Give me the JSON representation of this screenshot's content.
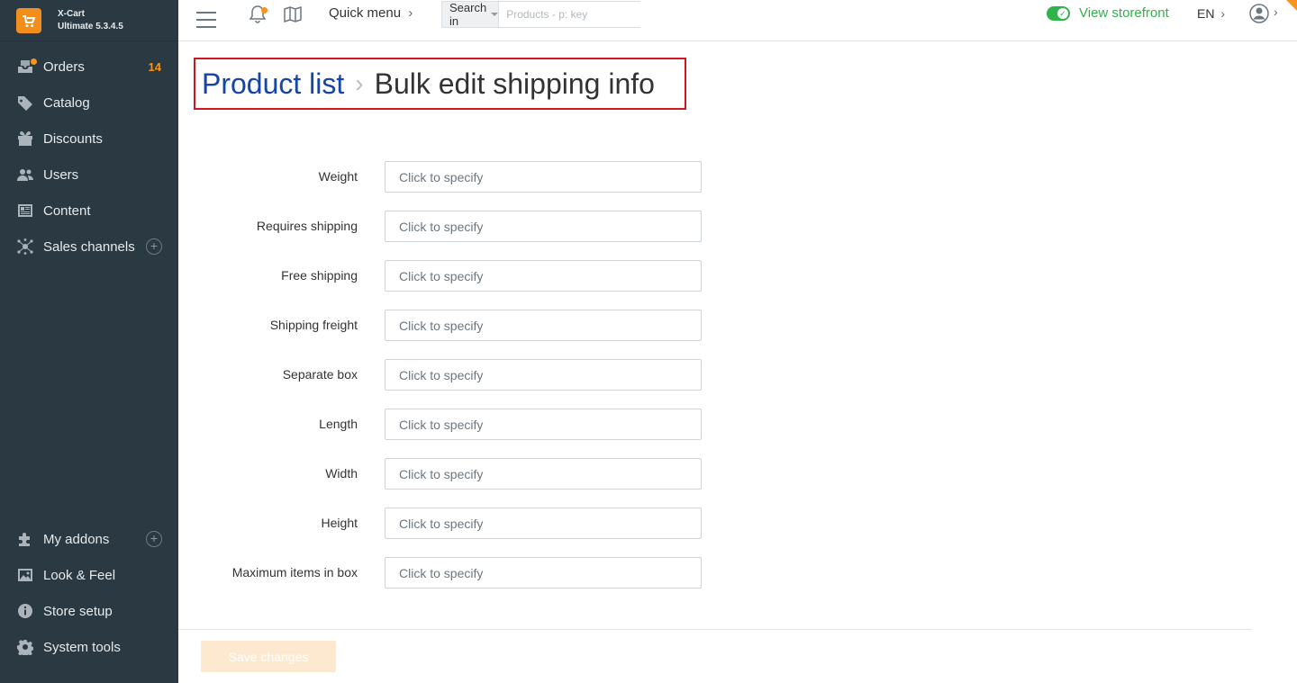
{
  "app": {
    "name": "X-Cart",
    "version": "Ultimate 5.3.4.5",
    "accent": "#f7941d",
    "link_color": "#1645a8",
    "success_color": "#2fb34a"
  },
  "sidebar": {
    "top_items": [
      {
        "label": "Orders",
        "icon": "orders-icon",
        "badge": "14"
      },
      {
        "label": "Catalog",
        "icon": "tag-icon"
      },
      {
        "label": "Discounts",
        "icon": "gift-icon"
      },
      {
        "label": "Users",
        "icon": "users-icon"
      },
      {
        "label": "Content",
        "icon": "content-icon"
      },
      {
        "label": "Sales channels",
        "icon": "sales-channels-icon",
        "plus": "+"
      }
    ],
    "bottom_items": [
      {
        "label": "My addons",
        "icon": "puzzle-icon",
        "plus": "+"
      },
      {
        "label": "Look & Feel",
        "icon": "image-icon"
      },
      {
        "label": "Store setup",
        "icon": "info-icon"
      },
      {
        "label": "System tools",
        "icon": "gear-icon"
      }
    ]
  },
  "topbar": {
    "quick_menu": "Quick menu",
    "search_in": "Search in",
    "search_placeholder": "Products - p: key",
    "storefront": "View storefront",
    "language": "EN",
    "chevron": "›"
  },
  "breadcrumb": {
    "parent": "Product list",
    "separator": "›",
    "current": "Bulk edit shipping info"
  },
  "form": {
    "placeholder": "Click to specify",
    "fields": [
      {
        "label": "Weight"
      },
      {
        "label": "Requires shipping"
      },
      {
        "label": "Free shipping"
      },
      {
        "label": "Shipping freight"
      },
      {
        "label": "Separate box"
      },
      {
        "label": "Length"
      },
      {
        "label": "Width"
      },
      {
        "label": "Height"
      },
      {
        "label": "Maximum items in box"
      }
    ]
  },
  "actions": {
    "save": "Save changes"
  }
}
